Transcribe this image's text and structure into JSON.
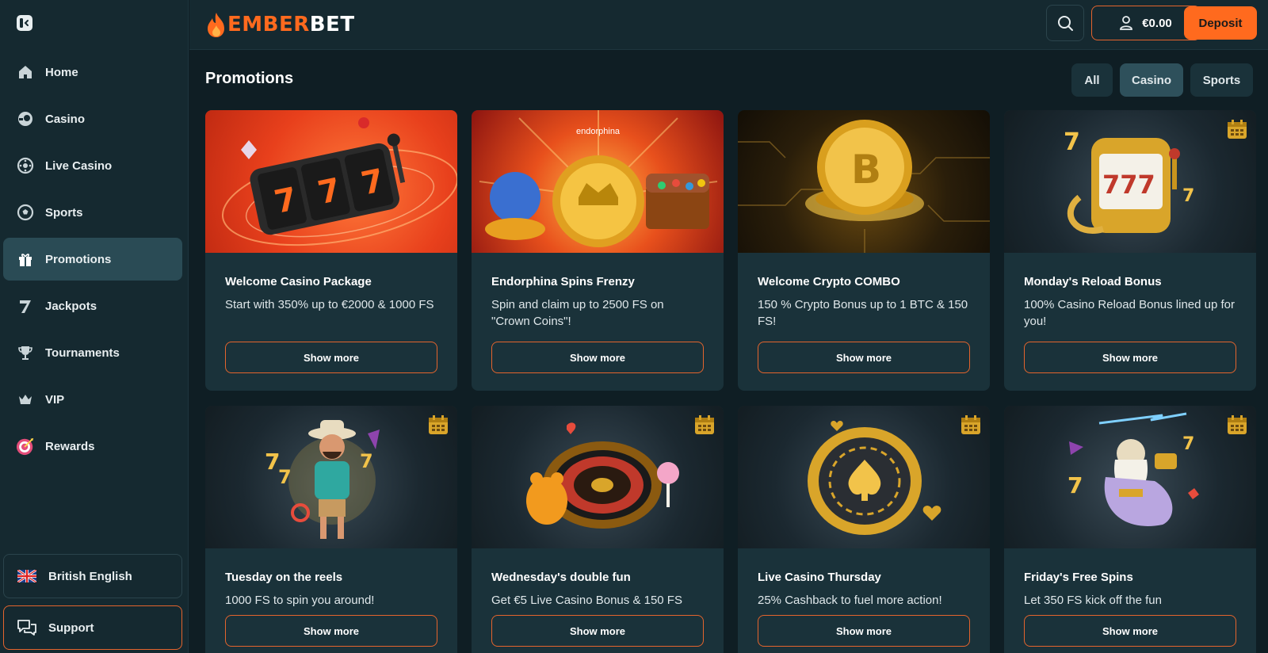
{
  "brand": {
    "part1": "EMBER",
    "part2": "BET",
    "accent": "#ff6a1e"
  },
  "sidebar": {
    "items": [
      {
        "label": "Home",
        "icon": "home-icon"
      },
      {
        "label": "Casino",
        "icon": "casino-chip-icon"
      },
      {
        "label": "Live Casino",
        "icon": "roulette-icon"
      },
      {
        "label": "Sports",
        "icon": "soccer-ball-icon"
      },
      {
        "label": "Promotions",
        "icon": "gift-icon",
        "active": true
      },
      {
        "label": "Jackpots",
        "icon": "seven-icon"
      },
      {
        "label": "Tournaments",
        "icon": "trophy-icon"
      },
      {
        "label": "VIP",
        "icon": "crown-icon"
      },
      {
        "label": "Rewards",
        "icon": "target-icon"
      }
    ],
    "language": "British English",
    "support": "Support"
  },
  "header": {
    "balance": "€0.00",
    "deposit": "Deposit"
  },
  "main": {
    "title": "Promotions",
    "filters": [
      "All",
      "Casino",
      "Sports"
    ],
    "active_filter": "Casino",
    "cards": [
      {
        "title": "Welcome Casino Package",
        "desc": "Start with 350% up to €2000 & 1000 FS",
        "button": "Show more"
      },
      {
        "title": "Endorphina Spins Frenzy",
        "desc": "Spin and claim up to 2500 FS on \"Crown Coins\"!",
        "button": "Show more",
        "art_brand": "endorphina"
      },
      {
        "title": "Welcome Crypto COMBO",
        "desc": "150 % Crypto Bonus up to 1 BTC & 150 FS!",
        "button": "Show more"
      },
      {
        "title": "Monday's Reload Bonus",
        "desc": "100% Casino Reload Bonus lined up for you!",
        "button": "Show more"
      },
      {
        "title": "Tuesday on the reels",
        "desc": "1000 FS to spin you around!",
        "button": "Show more"
      },
      {
        "title": "Wednesday's double fun",
        "desc": "Get €5 Live Casino Bonus & 150 FS",
        "button": "Show more"
      },
      {
        "title": "Live Casino Thursday",
        "desc": "25% Cashback to fuel more action!",
        "button": "Show more"
      },
      {
        "title": "Friday's Free Spins",
        "desc": "Let 350 FS kick off the fun",
        "button": "Show more"
      }
    ]
  }
}
